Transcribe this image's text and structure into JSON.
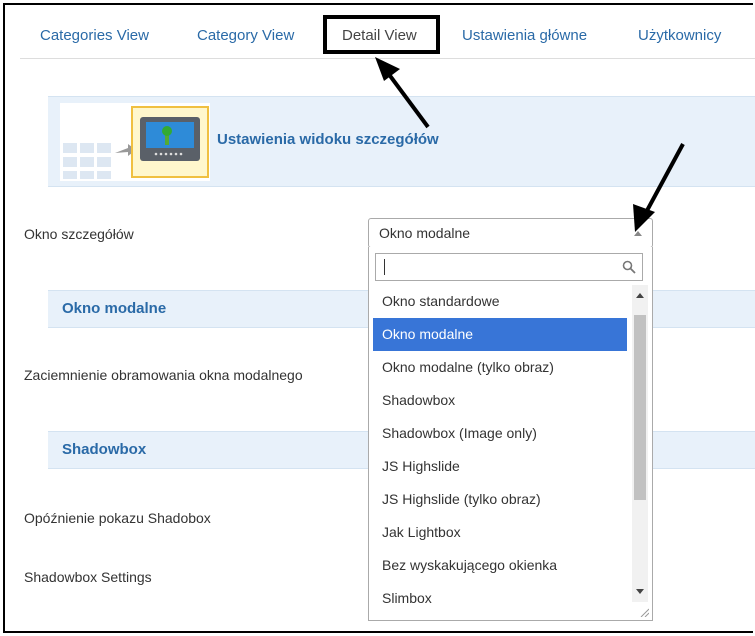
{
  "tabs": [
    "Categories View",
    "Category View",
    "Detail View",
    "Ustawienia główne",
    "Użytkownicy"
  ],
  "header_section": {
    "title": "Ustawienia widoku szczegółów",
    "icon": "detail-view-icon"
  },
  "rows": {
    "detail_window": "Okno szczegółów",
    "modal_overlay": "Zaciemnienie obramowania okna modalnego",
    "shadowbox_delay": "Opóźnienie pokazu Shadobox",
    "shadowbox_settings": "Shadowbox Settings"
  },
  "sections": {
    "modal": "Okno modalne",
    "shadowbox": "Shadowbox"
  },
  "select": {
    "value": "Okno modalne",
    "search_value": "",
    "options": [
      "Okno standardowe",
      "Okno modalne",
      "Okno modalne (tylko obraz)",
      "Shadowbox",
      "Shadowbox (Image only)",
      "JS Highslide",
      "JS Highslide (tylko obraz)",
      "Jak Lightbox",
      "Bez wyskakującego okienka",
      "Slimbox"
    ],
    "selected_index": 1
  },
  "colors": {
    "link": "#2a6aa7",
    "selected": "#3875d7",
    "section_bg": "#e8f1fa"
  }
}
